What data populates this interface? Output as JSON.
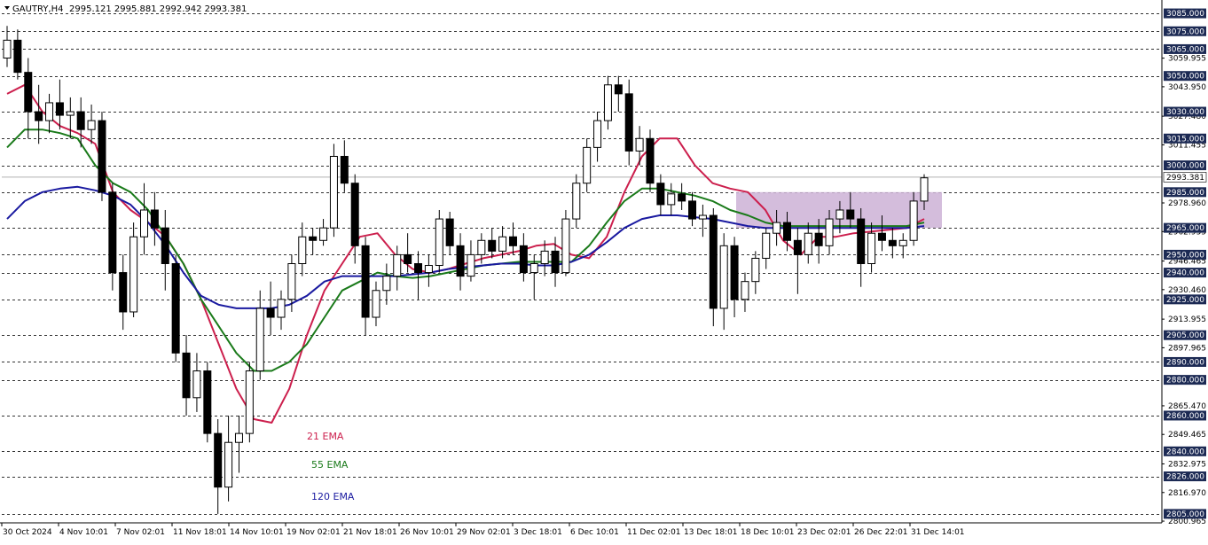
{
  "header": {
    "symbol": "GAUTRY,H4",
    "ohlc": "2995.121 2995.881 2992.942 2993.381"
  },
  "chart_data": {
    "type": "candlestick",
    "title": "",
    "symbol": "GAUTRY",
    "timeframe": "H4",
    "ylim": [
      2800,
      3090
    ],
    "y_ticks": [
      "3059.955",
      "3043.950",
      "3027.480",
      "3011.455",
      "2978.960",
      "2962.935",
      "2946.465",
      "2930.460",
      "2913.955",
      "2897.965",
      "2865.470",
      "2849.465",
      "2832.975",
      "2816.970",
      "2800.965"
    ],
    "level_tags": [
      "3085.000",
      "3075.000",
      "3065.000",
      "3050.000",
      "3030.000",
      "3015.000",
      "3000.000",
      "2985.000",
      "2965.000",
      "2950.000",
      "2940.000",
      "2925.000",
      "2905.000",
      "2890.000",
      "2880.000",
      "2860.000",
      "2840.000",
      "2826.000",
      "2805.000"
    ],
    "levels": [
      3085,
      3075,
      3065,
      3050,
      3030,
      3015,
      3000,
      2985,
      2965,
      2950,
      2940,
      2925,
      2905,
      2890,
      2880,
      2860,
      2840,
      2826,
      2805
    ],
    "current_price": "2993.381",
    "current_price_value": 2993.381,
    "x_ticks": [
      "30 Oct 2024",
      "4 Nov 10:01",
      "7 Nov 02:01",
      "11 Nov 18:01",
      "14 Nov 10:01",
      "19 Nov 02:01",
      "21 Nov 18:01",
      "26 Nov 10:01",
      "29 Nov 02:01",
      "3 Dec 18:01",
      "6 Dec 10:01",
      "11 Dec 02:01",
      "13 Dec 18:01",
      "18 Dec 10:01",
      "23 Dec 02:01",
      "26 Dec 22:01",
      "31 Dec 14:01"
    ],
    "zone": {
      "low": 2965,
      "high": 2985,
      "from": "13 Dec 18:01",
      "to": "31 Dec 14:01"
    },
    "series": [
      {
        "name": "21 EMA",
        "color": "#cc1f4d",
        "values": [
          3040,
          3045,
          3030,
          3022,
          3018,
          3012,
          2985,
          2975,
          2968,
          2960,
          2945,
          2925,
          2900,
          2875,
          2858,
          2856,
          2875,
          2905,
          2930,
          2945,
          2960,
          2962,
          2950,
          2942,
          2940,
          2942,
          2945,
          2948,
          2950,
          2952,
          2955,
          2956,
          2950,
          2948,
          2960,
          2985,
          3005,
          3015,
          3015,
          3000,
          2990,
          2987,
          2985,
          2975,
          2958,
          2950,
          2960,
          2960,
          2962,
          2963,
          2964,
          2965,
          2970
        ]
      },
      {
        "name": "55 EMA",
        "color": "#1a7a1a",
        "values": [
          3010,
          3020,
          3020,
          3018,
          3015,
          3000,
          2990,
          2985,
          2975,
          2960,
          2945,
          2925,
          2910,
          2895,
          2885,
          2885,
          2890,
          2900,
          2915,
          2930,
          2935,
          2940,
          2938,
          2937,
          2938,
          2940,
          2942,
          2944,
          2945,
          2946,
          2946,
          2946,
          2946,
          2955,
          2968,
          2980,
          2987,
          2987,
          2985,
          2983,
          2980,
          2975,
          2972,
          2968,
          2966,
          2966,
          2966,
          2966,
          2966,
          2966,
          2966,
          2966,
          2968
        ]
      },
      {
        "name": "120 EMA",
        "color": "#1a1aa0",
        "values": [
          2970,
          2980,
          2985,
          2987,
          2988,
          2986,
          2983,
          2978,
          2968,
          2955,
          2940,
          2927,
          2922,
          2920,
          2920,
          2920,
          2922,
          2927,
          2935,
          2938,
          2938,
          2938,
          2938,
          2939,
          2940,
          2942,
          2943,
          2944,
          2945,
          2945,
          2944,
          2944,
          2946,
          2950,
          2957,
          2965,
          2970,
          2972,
          2972,
          2971,
          2970,
          2968,
          2966,
          2965,
          2965,
          2965,
          2965,
          2965,
          2965,
          2965,
          2965,
          2965,
          2966
        ]
      }
    ],
    "legend": [
      "21 EMA",
      "55 EMA",
      "120 EMA"
    ],
    "candles": [
      {
        "o": 3060,
        "h": 3078,
        "l": 3055,
        "c": 3070
      },
      {
        "o": 3070,
        "h": 3076,
        "l": 3048,
        "c": 3052
      },
      {
        "o": 3052,
        "h": 3060,
        "l": 3015,
        "c": 3030
      },
      {
        "o": 3030,
        "h": 3045,
        "l": 3012,
        "c": 3025
      },
      {
        "o": 3025,
        "h": 3040,
        "l": 3018,
        "c": 3035
      },
      {
        "o": 3035,
        "h": 3048,
        "l": 3020,
        "c": 3028
      },
      {
        "o": 3028,
        "h": 3038,
        "l": 3015,
        "c": 3030
      },
      {
        "o": 3030,
        "h": 3038,
        "l": 3010,
        "c": 3020
      },
      {
        "o": 3020,
        "h": 3034,
        "l": 3012,
        "c": 3025
      },
      {
        "o": 3025,
        "h": 3030,
        "l": 2980,
        "c": 2985
      },
      {
        "o": 2985,
        "h": 2990,
        "l": 2930,
        "c": 2940
      },
      {
        "o": 2940,
        "h": 2950,
        "l": 2908,
        "c": 2918
      },
      {
        "o": 2918,
        "h": 2968,
        "l": 2915,
        "c": 2960
      },
      {
        "o": 2960,
        "h": 2990,
        "l": 2950,
        "c": 2975
      },
      {
        "o": 2975,
        "h": 2985,
        "l": 2955,
        "c": 2965
      },
      {
        "o": 2965,
        "h": 2975,
        "l": 2930,
        "c": 2945
      },
      {
        "o": 2945,
        "h": 2950,
        "l": 2890,
        "c": 2895
      },
      {
        "o": 2895,
        "h": 2905,
        "l": 2860,
        "c": 2870
      },
      {
        "o": 2870,
        "h": 2895,
        "l": 2862,
        "c": 2885
      },
      {
        "o": 2885,
        "h": 2890,
        "l": 2845,
        "c": 2850
      },
      {
        "o": 2850,
        "h": 2858,
        "l": 2805,
        "c": 2820
      },
      {
        "o": 2820,
        "h": 2860,
        "l": 2812,
        "c": 2845
      },
      {
        "o": 2845,
        "h": 2860,
        "l": 2828,
        "c": 2850
      },
      {
        "o": 2850,
        "h": 2890,
        "l": 2845,
        "c": 2885
      },
      {
        "o": 2885,
        "h": 2930,
        "l": 2880,
        "c": 2920
      },
      {
        "o": 2920,
        "h": 2935,
        "l": 2905,
        "c": 2915
      },
      {
        "o": 2915,
        "h": 2930,
        "l": 2908,
        "c": 2925
      },
      {
        "o": 2925,
        "h": 2950,
        "l": 2918,
        "c": 2945
      },
      {
        "o": 2945,
        "h": 2968,
        "l": 2938,
        "c": 2960
      },
      {
        "o": 2960,
        "h": 2965,
        "l": 2950,
        "c": 2958
      },
      {
        "o": 2958,
        "h": 2970,
        "l": 2955,
        "c": 2965
      },
      {
        "o": 2965,
        "h": 3012,
        "l": 2960,
        "c": 3005
      },
      {
        "o": 3005,
        "h": 3014,
        "l": 2985,
        "c": 2990
      },
      {
        "o": 2990,
        "h": 2995,
        "l": 2945,
        "c": 2955
      },
      {
        "o": 2955,
        "h": 2960,
        "l": 2905,
        "c": 2915
      },
      {
        "o": 2915,
        "h": 2935,
        "l": 2910,
        "c": 2930
      },
      {
        "o": 2930,
        "h": 2945,
        "l": 2922,
        "c": 2938
      },
      {
        "o": 2938,
        "h": 2955,
        "l": 2930,
        "c": 2950
      },
      {
        "o": 2950,
        "h": 2962,
        "l": 2940,
        "c": 2945
      },
      {
        "o": 2945,
        "h": 2952,
        "l": 2925,
        "c": 2940
      },
      {
        "o": 2940,
        "h": 2950,
        "l": 2932,
        "c": 2944
      },
      {
        "o": 2944,
        "h": 2975,
        "l": 2940,
        "c": 2970
      },
      {
        "o": 2970,
        "h": 2974,
        "l": 2950,
        "c": 2955
      },
      {
        "o": 2955,
        "h": 2962,
        "l": 2930,
        "c": 2938
      },
      {
        "o": 2938,
        "h": 2958,
        "l": 2935,
        "c": 2950
      },
      {
        "o": 2950,
        "h": 2962,
        "l": 2945,
        "c": 2958
      },
      {
        "o": 2958,
        "h": 2965,
        "l": 2948,
        "c": 2952
      },
      {
        "o": 2952,
        "h": 2966,
        "l": 2948,
        "c": 2960
      },
      {
        "o": 2960,
        "h": 2968,
        "l": 2950,
        "c": 2955
      },
      {
        "o": 2955,
        "h": 2962,
        "l": 2935,
        "c": 2940
      },
      {
        "o": 2940,
        "h": 2950,
        "l": 2925,
        "c": 2945
      },
      {
        "o": 2945,
        "h": 2958,
        "l": 2938,
        "c": 2952
      },
      {
        "o": 2952,
        "h": 2960,
        "l": 2932,
        "c": 2940
      },
      {
        "o": 2940,
        "h": 2975,
        "l": 2938,
        "c": 2970
      },
      {
        "o": 2970,
        "h": 2995,
        "l": 2965,
        "c": 2990
      },
      {
        "o": 2990,
        "h": 3015,
        "l": 2985,
        "c": 3010
      },
      {
        "o": 3010,
        "h": 3030,
        "l": 3002,
        "c": 3025
      },
      {
        "o": 3025,
        "h": 3050,
        "l": 3020,
        "c": 3045
      },
      {
        "o": 3045,
        "h": 3050,
        "l": 3030,
        "c": 3040
      },
      {
        "o": 3040,
        "h": 3048,
        "l": 3000,
        "c": 3008
      },
      {
        "o": 3008,
        "h": 3022,
        "l": 3000,
        "c": 3015
      },
      {
        "o": 3015,
        "h": 3020,
        "l": 2985,
        "c": 2990
      },
      {
        "o": 2990,
        "h": 2995,
        "l": 2972,
        "c": 2978
      },
      {
        "o": 2978,
        "h": 2990,
        "l": 2972,
        "c": 2984
      },
      {
        "o": 2984,
        "h": 2990,
        "l": 2975,
        "c": 2980
      },
      {
        "o": 2980,
        "h": 2985,
        "l": 2966,
        "c": 2970
      },
      {
        "o": 2970,
        "h": 2978,
        "l": 2960,
        "c": 2972
      },
      {
        "o": 2972,
        "h": 2976,
        "l": 2910,
        "c": 2920
      },
      {
        "o": 2920,
        "h": 2962,
        "l": 2908,
        "c": 2955
      },
      {
        "o": 2955,
        "h": 2960,
        "l": 2915,
        "c": 2925
      },
      {
        "o": 2925,
        "h": 2940,
        "l": 2918,
        "c": 2935
      },
      {
        "o": 2935,
        "h": 2952,
        "l": 2928,
        "c": 2948
      },
      {
        "o": 2948,
        "h": 2965,
        "l": 2942,
        "c": 2962
      },
      {
        "o": 2962,
        "h": 2975,
        "l": 2955,
        "c": 2968
      },
      {
        "o": 2968,
        "h": 2974,
        "l": 2952,
        "c": 2958
      },
      {
        "o": 2958,
        "h": 2965,
        "l": 2928,
        "c": 2950
      },
      {
        "o": 2950,
        "h": 2968,
        "l": 2945,
        "c": 2962
      },
      {
        "o": 2962,
        "h": 2970,
        "l": 2945,
        "c": 2955
      },
      {
        "o": 2955,
        "h": 2975,
        "l": 2950,
        "c": 2970
      },
      {
        "o": 2970,
        "h": 2980,
        "l": 2962,
        "c": 2975
      },
      {
        "o": 2975,
        "h": 2985,
        "l": 2965,
        "c": 2970
      },
      {
        "o": 2970,
        "h": 2976,
        "l": 2932,
        "c": 2945
      },
      {
        "o": 2945,
        "h": 2968,
        "l": 2940,
        "c": 2962
      },
      {
        "o": 2962,
        "h": 2972,
        "l": 2952,
        "c": 2958
      },
      {
        "o": 2958,
        "h": 2965,
        "l": 2948,
        "c": 2955
      },
      {
        "o": 2955,
        "h": 2962,
        "l": 2948,
        "c": 2958
      },
      {
        "o": 2958,
        "h": 2985,
        "l": 2955,
        "c": 2980
      },
      {
        "o": 2980,
        "h": 2995,
        "l": 2975,
        "c": 2993
      }
    ]
  }
}
